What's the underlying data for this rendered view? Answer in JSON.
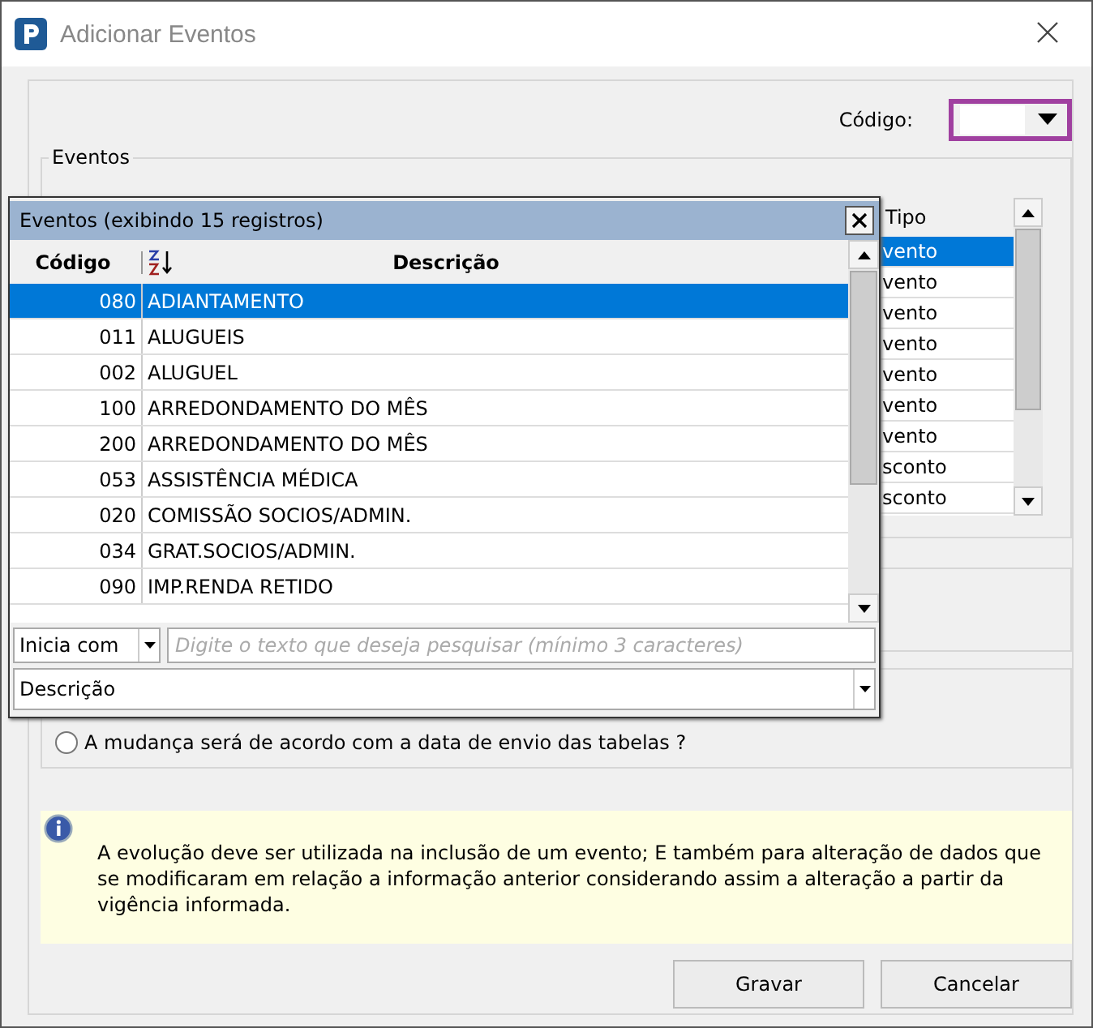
{
  "window": {
    "title": "Adicionar Eventos"
  },
  "codigo": {
    "label": "Código:"
  },
  "eventos_group": {
    "title": "Eventos",
    "table": {
      "columns": [
        "Tipo"
      ],
      "rows": [
        {
          "tipo": "vento",
          "selected": true
        },
        {
          "tipo": "vento",
          "selected": false
        },
        {
          "tipo": "vento",
          "selected": false
        },
        {
          "tipo": "vento",
          "selected": false
        },
        {
          "tipo": "vento",
          "selected": false
        },
        {
          "tipo": "vento",
          "selected": false
        },
        {
          "tipo": "vento",
          "selected": false
        },
        {
          "tipo": "sconto",
          "selected": false
        },
        {
          "tipo": "sconto",
          "selected": false
        }
      ]
    }
  },
  "radio": {
    "label": "A mudança será de acordo com a data de envio das tabelas ?",
    "checked": false
  },
  "info": {
    "text": "A evolução deve ser utilizada na inclusão de um evento; E também para alteração de dados que se modificaram em relação a informação anterior considerando assim a alteração a partir da vigência informada."
  },
  "buttons": [
    "Gravar",
    "Cancelar"
  ],
  "popup": {
    "title": "Eventos (exibindo 15 registros)",
    "columns": [
      "Código",
      "Descrição"
    ],
    "rows": [
      {
        "codigo": "080",
        "descricao": "ADIANTAMENTO",
        "selected": true
      },
      {
        "codigo": "011",
        "descricao": "ALUGUEIS",
        "selected": false
      },
      {
        "codigo": "002",
        "descricao": "ALUGUEL",
        "selected": false
      },
      {
        "codigo": "100",
        "descricao": "ARREDONDAMENTO DO MÊS",
        "selected": false
      },
      {
        "codigo": "200",
        "descricao": "ARREDONDAMENTO DO MÊS",
        "selected": false
      },
      {
        "codigo": "053",
        "descricao": "ASSISTÊNCIA MÉDICA",
        "selected": false
      },
      {
        "codigo": "020",
        "descricao": "COMISSÃO SOCIOS/ADMIN.",
        "selected": false
      },
      {
        "codigo": "034",
        "descricao": "GRAT.SOCIOS/ADMIN.",
        "selected": false
      },
      {
        "codigo": "090",
        "descricao": "IMP.RENDA RETIDO",
        "selected": false
      }
    ],
    "match_mode": "Inicia com",
    "search_placeholder": "Digite o texto que deseja pesquisar (mínimo 3 caracteres)",
    "search_field": "Descrição"
  }
}
